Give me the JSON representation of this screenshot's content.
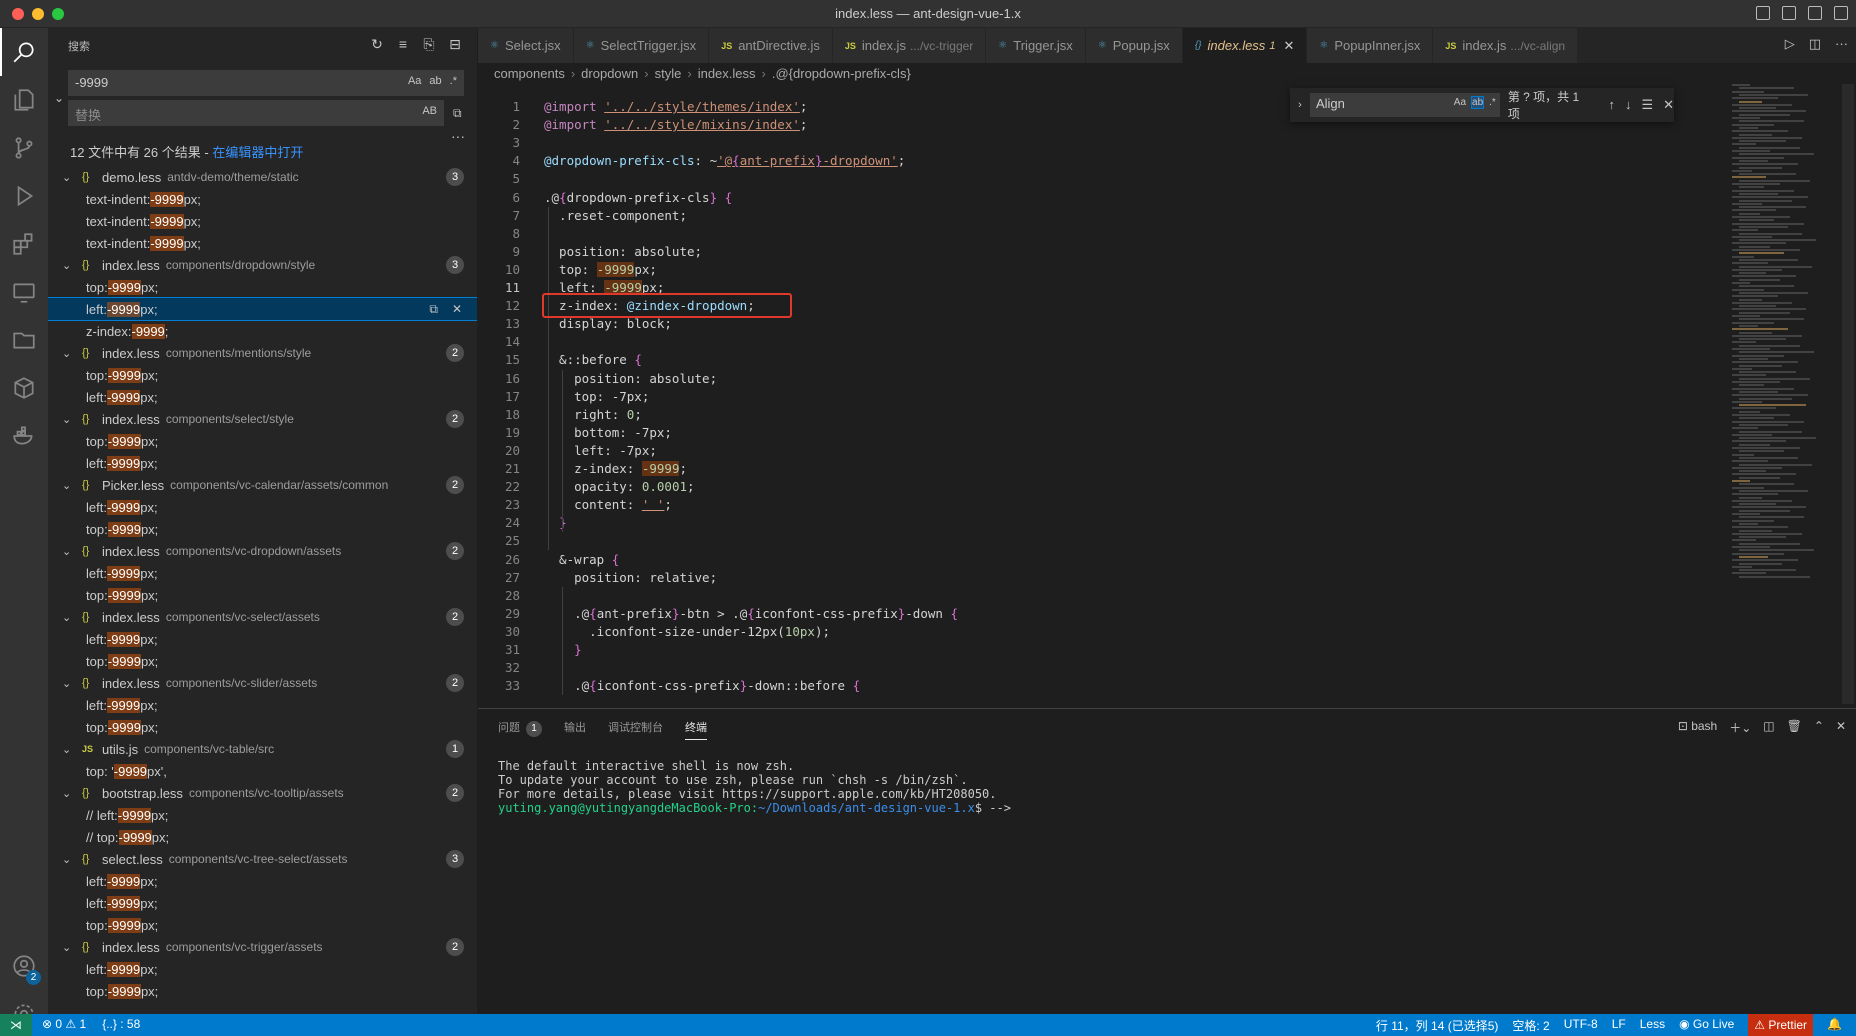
{
  "window": {
    "title": "index.less — ant-design-vue-1.x"
  },
  "sidebar": {
    "header": "搜索",
    "search_value": "-9999",
    "search_opts": [
      "Aa",
      "ab",
      ".*"
    ],
    "replace_placeholder": "替换",
    "replace_opt": "AB",
    "summary_text": "12 文件中有 26 个结果 - ",
    "summary_link": "在编辑器中打开",
    "files": [
      {
        "name": "demo.less",
        "path": "antdv-demo/theme/static",
        "count": "3",
        "type": "less",
        "matches": [
          [
            "text-indent: ",
            "-9999",
            "px;"
          ],
          [
            "text-indent: ",
            "-9999",
            "px;"
          ],
          [
            "text-indent: ",
            "-9999",
            "px;"
          ]
        ]
      },
      {
        "name": "index.less",
        "path": "components/dropdown/style",
        "count": "3",
        "type": "less",
        "matches": [
          [
            "top: ",
            "-9999",
            "px;"
          ],
          [
            "left: ",
            "-9999",
            "px;"
          ],
          [
            "z-index: ",
            "-9999",
            ";"
          ]
        ]
      },
      {
        "name": "index.less",
        "path": "components/mentions/style",
        "count": "2",
        "type": "less",
        "matches": [
          [
            "top: ",
            "-9999",
            "px;"
          ],
          [
            "left: ",
            "-9999",
            "px;"
          ]
        ]
      },
      {
        "name": "index.less",
        "path": "components/select/style",
        "count": "2",
        "type": "less",
        "matches": [
          [
            "top: ",
            "-9999",
            "px;"
          ],
          [
            "left: ",
            "-9999",
            "px;"
          ]
        ]
      },
      {
        "name": "Picker.less",
        "path": "components/vc-calendar/assets/common",
        "count": "2",
        "type": "less",
        "matches": [
          [
            "left: ",
            "-9999",
            "px;"
          ],
          [
            "top: ",
            "-9999",
            "px;"
          ]
        ]
      },
      {
        "name": "index.less",
        "path": "components/vc-dropdown/assets",
        "count": "2",
        "type": "less",
        "matches": [
          [
            "left: ",
            "-9999",
            "px;"
          ],
          [
            "top: ",
            "-9999",
            "px;"
          ]
        ]
      },
      {
        "name": "index.less",
        "path": "components/vc-select/assets",
        "count": "2",
        "type": "less",
        "matches": [
          [
            "left: ",
            "-9999",
            "px;"
          ],
          [
            "top: ",
            "-9999",
            "px;"
          ]
        ]
      },
      {
        "name": "index.less",
        "path": "components/vc-slider/assets",
        "count": "2",
        "type": "less",
        "matches": [
          [
            "left: ",
            "-9999",
            "px;"
          ],
          [
            "top: ",
            "-9999",
            "px;"
          ]
        ]
      },
      {
        "name": "utils.js",
        "path": "components/vc-table/src",
        "count": "1",
        "type": "js",
        "matches": [
          [
            "top: '",
            "-9999",
            "px',"
          ]
        ]
      },
      {
        "name": "bootstrap.less",
        "path": "components/vc-tooltip/assets",
        "count": "2",
        "type": "less",
        "matches": [
          [
            "// left: ",
            "-9999",
            "px;"
          ],
          [
            "// top: ",
            "-9999",
            "px;"
          ]
        ]
      },
      {
        "name": "select.less",
        "path": "components/vc-tree-select/assets",
        "count": "3",
        "type": "less",
        "matches": [
          [
            "left: ",
            "-9999",
            "px;"
          ],
          [
            "left: ",
            "-9999",
            "px;"
          ],
          [
            "top: ",
            "-9999",
            "px;"
          ]
        ]
      },
      {
        "name": "index.less",
        "path": "components/vc-trigger/assets",
        "count": "2",
        "type": "less",
        "matches": [
          [
            "left: ",
            "-9999",
            "px;"
          ],
          [
            "top: ",
            "-9999",
            "px;"
          ]
        ]
      }
    ]
  },
  "tabs": [
    {
      "label": "Select.jsx",
      "desc": "",
      "type": "jsx"
    },
    {
      "label": "SelectTrigger.jsx",
      "desc": "",
      "type": "jsx"
    },
    {
      "label": "antDirective.js",
      "desc": "",
      "type": "js"
    },
    {
      "label": "index.js",
      "desc": ".../vc-trigger",
      "type": "js"
    },
    {
      "label": "Trigger.jsx",
      "desc": "",
      "type": "jsx"
    },
    {
      "label": "Popup.jsx",
      "desc": "",
      "type": "jsx"
    },
    {
      "label": "index.less",
      "desc": "1",
      "type": "less",
      "active": true
    },
    {
      "label": "PopupInner.jsx",
      "desc": "",
      "type": "jsx"
    },
    {
      "label": "index.js",
      "desc": ".../vc-align",
      "type": "js"
    }
  ],
  "breadcrumb": [
    "components",
    "dropdown",
    "style",
    "index.less",
    ".@{dropdown-prefix-cls}"
  ],
  "find": {
    "value": "Align",
    "opts": [
      "Aa",
      "ab",
      ".*"
    ],
    "count": "第 ? 项，共 1 项"
  },
  "editor": {
    "current_line": 11,
    "lines": [
      "@import '../../style/themes/index';",
      "@import '../../style/mixins/index';",
      "",
      "@dropdown-prefix-cls: ~'@{ant-prefix}-dropdown';",
      "",
      ".@{dropdown-prefix-cls} {",
      "  .reset-component;",
      "",
      "  position: absolute;",
      "  top: -9999px;",
      "  left: -9999px;",
      "  z-index: @zindex-dropdown;",
      "  display: block;",
      "",
      "  &::before {",
      "    position: absolute;",
      "    top: -7px;",
      "    right: 0;",
      "    bottom: -7px;",
      "    left: -7px;",
      "    z-index: -9999;",
      "    opacity: 0.0001;",
      "    content: ' ';",
      "  }",
      "",
      "  &-wrap {",
      "    position: relative;",
      "",
      "    .@{ant-prefix}-btn > .@{iconfont-css-prefix}-down {",
      "      .iconfont-size-under-12px(10px);",
      "    }",
      "",
      "    .@{iconfont-css-prefix}-down::before {"
    ]
  },
  "panel": {
    "tabs": [
      "问题",
      "输出",
      "调试控制台",
      "终端"
    ],
    "problems_count": "1",
    "active_tab": "终端",
    "shell": "bash",
    "terminal_lines": [
      "The default interactive shell is now zsh.",
      "To update your account to use zsh, please run `chsh -s /bin/zsh`.",
      "For more details, please visit https://support.apple.com/kb/HT208050."
    ],
    "prompt_user": "yuting.yang@yutingyangdeMacBook-Pro:",
    "prompt_path": "~/Downloads/ant-design-vue-1.x",
    "prompt_tail": "$ -->"
  },
  "statusbar": {
    "errors": "0",
    "warnings": "1",
    "scope": "{..} : 58",
    "position": "行 11，列 14 (已选择5)",
    "spaces": "空格: 2",
    "encoding": "UTF-8",
    "eol": "LF",
    "language": "Less",
    "golive": "Go Live",
    "prettier": "Prettier"
  },
  "activity": {
    "accounts_badge": "2"
  }
}
